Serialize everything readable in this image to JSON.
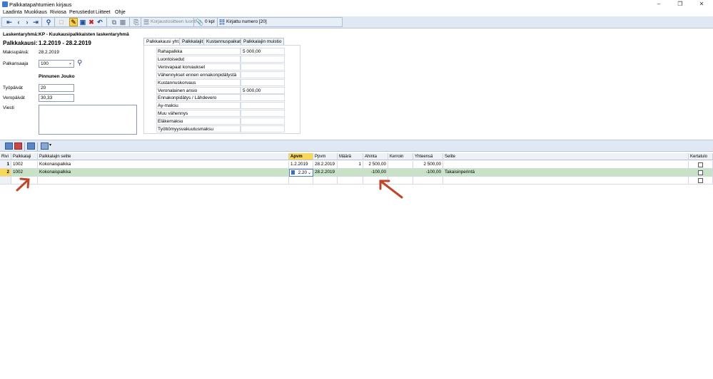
{
  "window": {
    "title": "Palkkatapahtumien kirjaus"
  },
  "menu": [
    "Laadinta",
    "Muokkaus",
    "Riviosa",
    "Perustiedot",
    "Liitteet",
    "Ohje"
  ],
  "toolbar": {
    "korjaus_label": "Korjaustositteen luonti",
    "attachments_label": "0 kpl",
    "record_label": "Kirjattu numero [20]"
  },
  "header": {
    "calc_group_label": "Laskentaryhmä:",
    "calc_group_value": "KP - Kuukausipalkkaisten laskentaryhmä",
    "period_label": "Palkkakausi:",
    "period_value": "1.2.2019  -  28.2.2019",
    "paydate_label": "Maksupäivä:",
    "paydate_value": "28.2.2019",
    "employee_label": "Palkansaaja",
    "employee_value": "100",
    "employee_name": "Pinnunen Jouko",
    "workdays_label": "Työpäivät",
    "workdays_value": "20",
    "taxdays_label": "Veropäivät",
    "taxdays_value": "30,33",
    "message_label": "Viesti"
  },
  "tabs": [
    "Palkkakausi yht.",
    "Palkkalajit",
    "Kustannuspaikat",
    "Palkkalajin muistio"
  ],
  "summary": [
    {
      "label": "Rahapalkka",
      "value": "5 000,00"
    },
    {
      "label": "Luontoisedut",
      "value": ""
    },
    {
      "label": "Verovapaat korvaukset",
      "value": ""
    },
    {
      "label": "Vähennykset ennen ennakonpidätystä",
      "value": ""
    },
    {
      "label": "Kustannuskorvaus",
      "value": ""
    },
    {
      "label": "Veronalainen ansio",
      "value": "5 000,00"
    },
    {
      "label": "Ennakonpidätys / Lähdevero",
      "value": ""
    },
    {
      "label": "Ay-maksu",
      "value": ""
    },
    {
      "label": "Muu vähennys",
      "value": ""
    },
    {
      "label": "Eläkemaksu",
      "value": ""
    },
    {
      "label": "Työttömyysvakuutusmaksu",
      "value": ""
    }
  ],
  "grid": {
    "columns": [
      "Rivi",
      "Palkkalaji",
      "Palkkalajin selite",
      "Apvm",
      "Ppvm",
      "Määrä",
      "Ahinta",
      "Kerroin",
      "Yhteensä",
      "Selite",
      "Kertatulo"
    ],
    "rows": [
      {
        "num": "1",
        "palkkalaji": "1002",
        "selite": "Kokonaispalkka",
        "apvm": "1.2.2019",
        "ppvm": "28.2.2019",
        "maara": "1",
        "ahinta": "2 500,00",
        "kerroin": "",
        "yhteensa": "2 500,00",
        "selite2": ""
      },
      {
        "num": "2",
        "palkkalaji": "1002",
        "selite": "Kokonaispalkka",
        "apvm": "2.20",
        "ppvm": "28.2.2019",
        "maara": "",
        "ahinta": "-100,00",
        "kerroin": "",
        "yhteensa": "-100,00",
        "selite2": "Takaisinperintä"
      }
    ]
  },
  "colors": {
    "accent": "#f9d75a",
    "selected_row": "#c8e2c6",
    "arrow": "#c0462a",
    "toolbar_bg": "#dfe8f3"
  }
}
